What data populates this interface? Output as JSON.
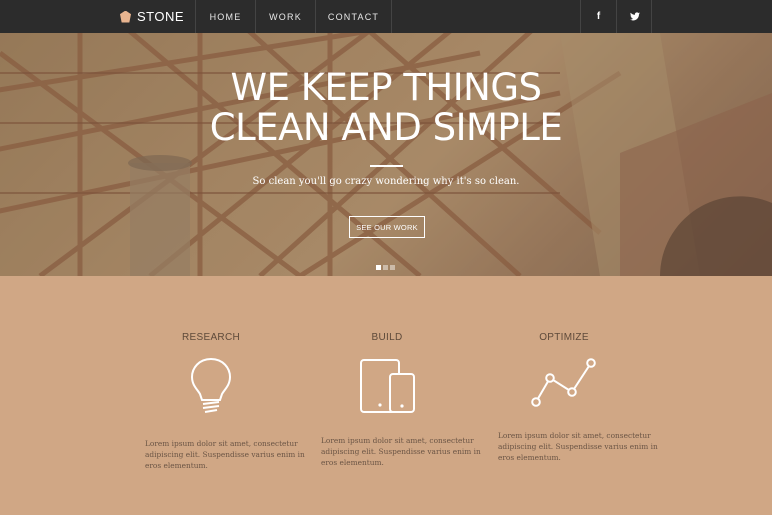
{
  "nav": {
    "brand": "STONE",
    "items": [
      "HOME",
      "WORK",
      "CONTACT"
    ],
    "social": [
      {
        "icon": "facebook-icon",
        "glyph": "f"
      },
      {
        "icon": "twitter-icon",
        "glyph": "🐦"
      }
    ]
  },
  "hero": {
    "headline_line1": "WE KEEP THINGS",
    "headline_line2": "CLEAN AND SIMPLE",
    "tagline": "So clean you'll go crazy wondering why it's so clean.",
    "cta": "SEE OUR WORK",
    "slides": 3,
    "active_slide": 1
  },
  "features": [
    {
      "title": "RESEARCH",
      "icon": "lightbulb-icon",
      "text": "Lorem ipsum dolor sit amet, consectetur adipiscing elit. Suspendisse varius enim in eros elementum."
    },
    {
      "title": "BUILD",
      "icon": "devices-icon",
      "text": "Lorem ipsum dolor sit amet, consectetur adipiscing elit. Suspendisse varius enim in eros elementum."
    },
    {
      "title": "OPTIMIZE",
      "icon": "line-chart-icon",
      "text": "Lorem ipsum dolor sit amet, consectetur adipiscing elit. Suspendisse varius enim in eros elementum."
    }
  ],
  "colors": {
    "nav_bg": "#2c2c2c",
    "accent": "#d0a785",
    "text_dark": "#5e4a3a"
  }
}
